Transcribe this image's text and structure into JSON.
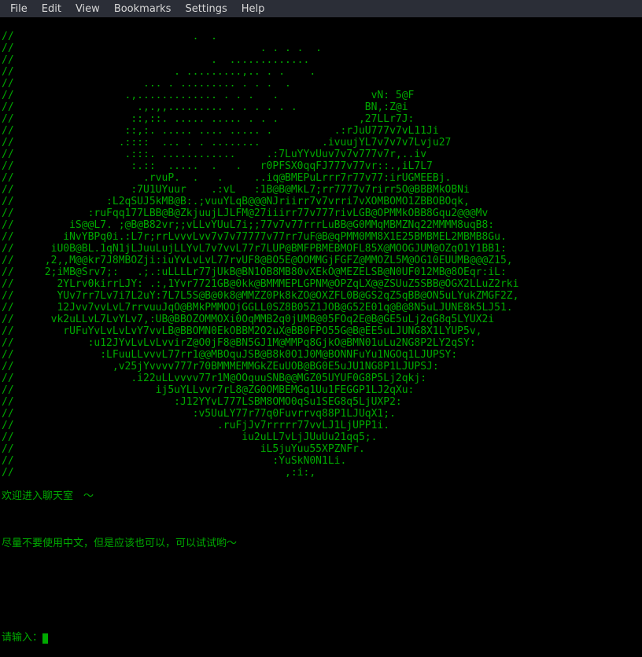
{
  "menubar": {
    "file": "File",
    "edit": "Edit",
    "view": "View",
    "bookmarks": "Bookmarks",
    "settings": "Settings",
    "help": "Help"
  },
  "ascii_art": [
    "//                             .  .                                                 ",
    "//                                        . . . .  .                                ",
    "//                                .  .............                                  ",
    "//                          . .........,.. . .    .                                 ",
    "//                     ... . ......... . . .  .                                     ",
    "//                  .,............. . . .   .               vN: 5@F                 ",
    "//                    .,.,,......... . . . . . .           BN,:Z@i                  ",
    "//                   ::,::. ..... ..... . . .             ,27LLr7J:                 ",
    "//                  ::,:. ..... .... ..... .          .:rJuU777v7vL11Ji             ",
    "//                 .::::  ... . . ........          .ivuujYL7v7v7v7Lvju27           ",
    "//                  .:::. ............     .:7LuYYvUuv7v7v777v7r,..iv               ",
    "//                   :.::  .....  .   .   r0PFSX0qqFJ777v77vr::.,iL7L7              ",
    "//                     .rvuP.  .   .     ..iq@BMEPuLrrr7r77v77:irUGMEEBj.           ",
    "//                   :7U1UYuur    .:vL   :1B@B@MkL7;rr7777v7rirr5O@BBBMkOBNi        ",
    "//               :L2qSUJ5kMB@B:.;vuuYLqB@@@NJriirr7v7vrri7vXOMBOMO1ZBBOBOqk,        ",
    "//            :ruFqq177LBB@B@ZkjuujLJLFM@27iiirr77v777rivLGB@OPMMkOBB8Gqu2@@@Mv     ",
    "//         iS@@L7. ;@B@B82vr;;vLLvYUuL7i;;77v7v77rrrLuBB@G0MMqMBMZNq22MMMM8uqB8:    ",
    "//        iNvYBPq0i.:L7r;rrLvvvLvv7v7v77777v77rr7uF@B@qPMM0MM8X1E25BMBMEL2MBMB8Gu.  ",
    "//      iU0B@BL.1qN1jLJuuLujLLYvL7v7vvL77r7LUP@BMFPBMEBMOFL85X@MOOGJUM@OZqO1Y1BB1:  ",
    "//     ,2,,M@@kr7J8MBOZji:iuYvLvLvL77rvUF8@BO5E@OOMMGjFGFZ@MMOZL5M@OG10EUUMB@@@Z15, ",
    "//     2;iMB@Srv7;:   .;.:uLLLLr77jUkB@BN1OB8MB80vXEkO@MEZELSB@N0UF012MB@8OEqr:iL:  ",
    "//       2YLrv0kirrLJY: .:,1Yvr7721GB@0kk@BMMMEPLGPNM@OPZqLX@@ZSUuZ5SBB@OGX2LLuZ2rki",
    "//       YUv7rr7Lv7i7L2uY:7L7L5S@B@0k8@MMZZ0Pk8kZO@OXZFL0B@GS2qZ5qBB@ON5uLYukZMGF2Z,",
    "//       12Jvv7vvLvL7rrvuuJqO@BMkPMMOOjGGLL0SZ8B05Z1JOB@G52E01q@B@8N5uLJUNE8k5LJ51. ",
    "//      vk2uLLvL7LvYLv7,:UB@BBOZOMMOXi0OqMMB2q0jUMB@05FOq2E@B@GE5uLj2qG8q5LYUX2i    ",
    "//        rUFuYvLvLvLvY7vvLB@BBOMN0EkOBBM2O2uX@BB0FPO55G@B@EE5uLJUNG8X1LYUP5v,      ",
    "//            :u12JYvLvLvLvvirZ@O0jF8@BN5GJ1M@MMPq8GjkO@BMN01uLu2NG8P2LY2qSY:       ",
    "//              :LFuuLLvvvL77rr1@@MBOquJSB@B8k0O1J0M@BONNFuYu1NGOq1LJUPSY:          ",
    "//                ,v25jYvvvv777r70BMMMEMMGkZEuUOB@BG0E5uJU1NG8P1LJUPSJ:             ",
    "//                   .i22uLLvvvv77r1M@OOquuSNB@@MGZ05UYUF0G8P5Lj2qkj:               ",
    "//                       ij5uYLLvvr7rL8@ZG0OMBEMGq1Uu1FEGGP1LJ2qXu:                 ",
    "//                          :J12YYvL777LSBM8OMO0qSu1SEG8q5LjUXP2:                   ",
    "//                             :v5UuLY77r77q0Fuvrrvq88P1LJUqX1;.                    ",
    "//                                 .ruFjJv7rrrrr77vvLJ1LjUPP1i.                     ",
    "//                                     iu2uLL7vLjJUuUu21qq5;.                       ",
    "//                                        iL5juYuu55XPZNFr.                         ",
    "//                                          :YuSkN0N1Li.                            ",
    "//                                            ,:i:,                                 "
  ],
  "welcome_line": "欢迎进入聊天室　～",
  "notice_line": "尽量不要使用中文，但是应该也可以，可以试试哟～",
  "prompt_label": "请输入："
}
